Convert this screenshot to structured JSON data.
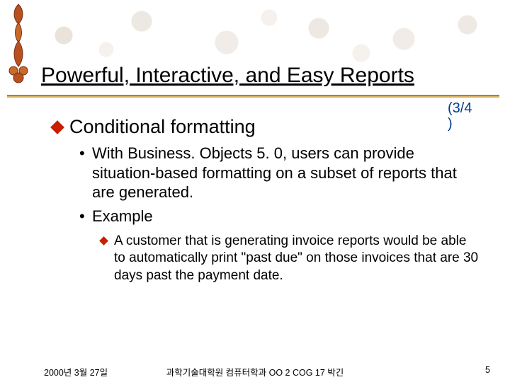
{
  "title": "Powerful, Interactive, and Easy Reports",
  "page_indicator": {
    "line1": "(3/4",
    "line2": ")"
  },
  "section_heading": "Conditional formatting",
  "bullets_level1": [
    "With Business. Objects 5. 0, users can provide situation-based formatting on a subset of reports that are generated.",
    "Example"
  ],
  "bullets_level2": [
    "A customer that is generating invoice reports would be able to automatically print \"past due\" on those invoices that are 30 days past the payment date."
  ],
  "footer": {
    "date": "2000년 3월 27일",
    "center": "과학기술대학원 컴퓨터학과 OO 2 COG 17 박긴",
    "page_number": "5"
  },
  "colors": {
    "accent_red": "#c62000",
    "indicator_blue": "#003b8e",
    "rule_gold_dark": "#b08030",
    "rule_gold_light": "#d9b56a"
  }
}
